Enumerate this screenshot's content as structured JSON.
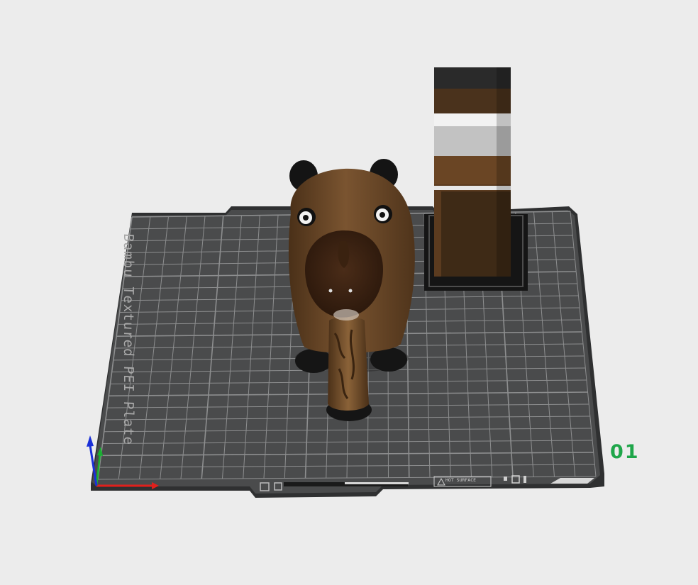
{
  "viewport": {
    "plate_label": "Bambu Textured PEI Plate",
    "plate_number": "01",
    "hot_surface_label": "HOT SURFACE"
  },
  "colors": {
    "background": "#ececec",
    "plate": "#4a4b4c",
    "grid": "#8d8e8f",
    "plate_number": "#1fa64a",
    "axis_x": "#e0201c",
    "axis_y": "#18b030",
    "axis_z": "#1a2fd8"
  },
  "objects": [
    {
      "name": "capybara-model",
      "icon": "capybara-model"
    },
    {
      "name": "wipe-tower",
      "icon": "prime-tower"
    }
  ],
  "axis_gizmo": [
    "x-axis-arrow",
    "y-axis-arrow",
    "z-axis-arrow"
  ]
}
